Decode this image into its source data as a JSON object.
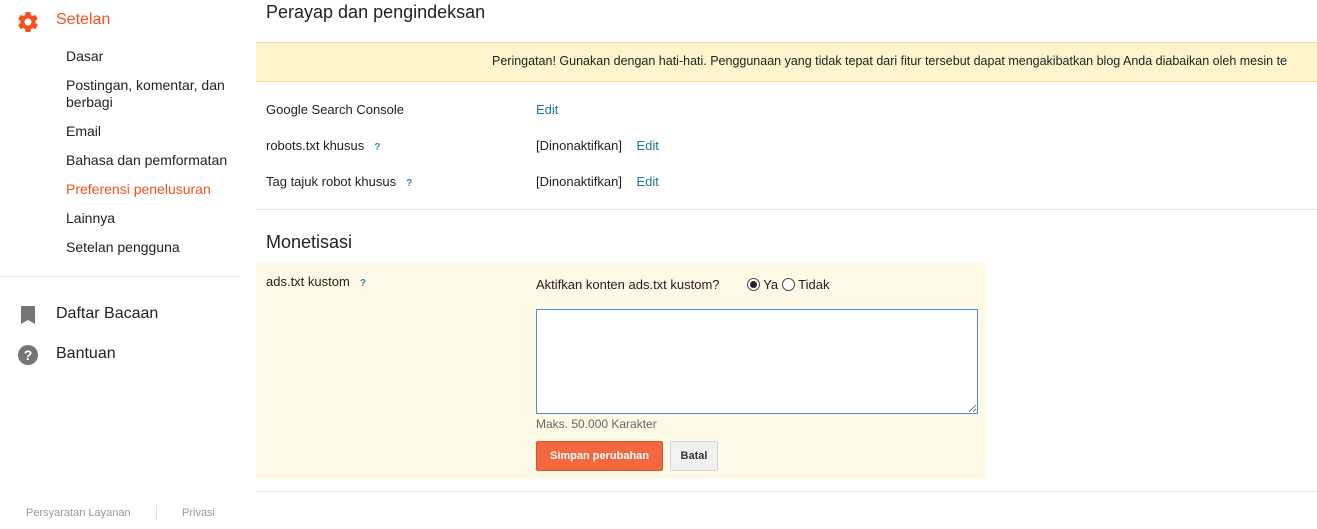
{
  "sidebar": {
    "title": "Setelan",
    "subitems": [
      "Dasar",
      "Postingan, komentar, dan berbagi",
      "Email",
      "Bahasa dan pemformatan",
      "Preferensi penelusuran",
      "Lainnya",
      "Setelan pengguna"
    ],
    "reading_list": "Daftar Bacaan",
    "help": "Bantuan",
    "footer": {
      "terms": "Persyaratan Layanan",
      "privacy": "Privasi"
    },
    "accent_color": "#f4511e"
  },
  "crawl": {
    "heading": "Perayap dan pengindeksan",
    "warning": "Peringatan! Gunakan dengan hati-hati. Penggunaan yang tidak tepat dari fitur tersebut dapat mengakibatkan blog Anda diabaikan oleh mesin te",
    "rows": [
      {
        "label": "Google Search Console",
        "help": "",
        "value": "",
        "action": "Edit"
      },
      {
        "label": "robots.txt khusus",
        "help": "?",
        "value": "[Dinonaktifkan]",
        "action": "Edit"
      },
      {
        "label": "Tag tajuk robot khusus",
        "help": "?",
        "value": "[Dinonaktifkan]",
        "action": "Edit"
      }
    ]
  },
  "monetization": {
    "heading": "Monetisasi",
    "ads_label": "ads.txt kustom",
    "help": "?",
    "question": "Aktifkan konten ads.txt kustom?",
    "option_yes": "Ya",
    "option_no": "Tidak",
    "selected": "Ya",
    "textarea_value": "",
    "max_note": "Maks. 50.000 Karakter",
    "save_label": "Simpan perubahan",
    "cancel_label": "Batal"
  }
}
